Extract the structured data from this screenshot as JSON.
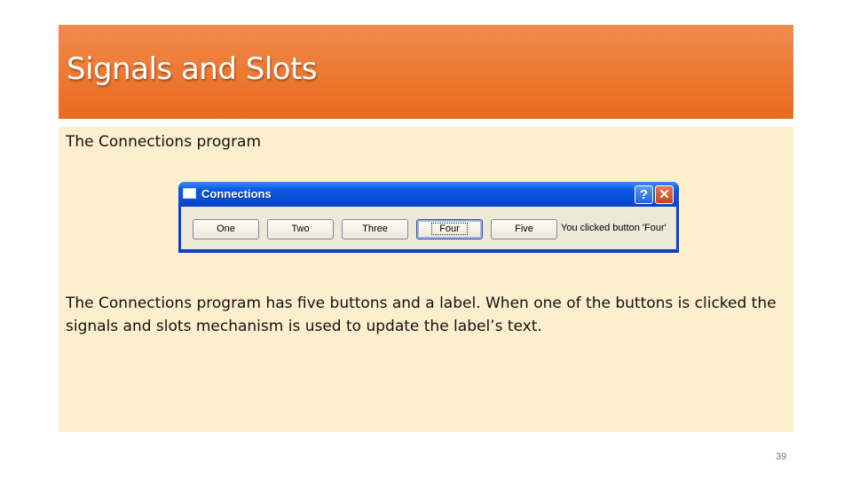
{
  "slide": {
    "title": "Signals and Slots",
    "heading": "The Connections program",
    "paragraph": "The Connections program has five buttons and a label. When one of the buttons is clicked the signals and slots mechanism is used to update the label’s text.",
    "page_number": "39"
  },
  "window": {
    "title": "Connections",
    "help_icon": "?",
    "close_icon": "✕",
    "buttons": [
      "One",
      "Two",
      "Three",
      "Four",
      "Five"
    ],
    "focused_button": "Four",
    "status_label": "You clicked button 'Four'"
  },
  "colors": {
    "title_bar": "#ee7a33",
    "content_bg": "#fdefce",
    "window_title": "#0a4fd9"
  }
}
